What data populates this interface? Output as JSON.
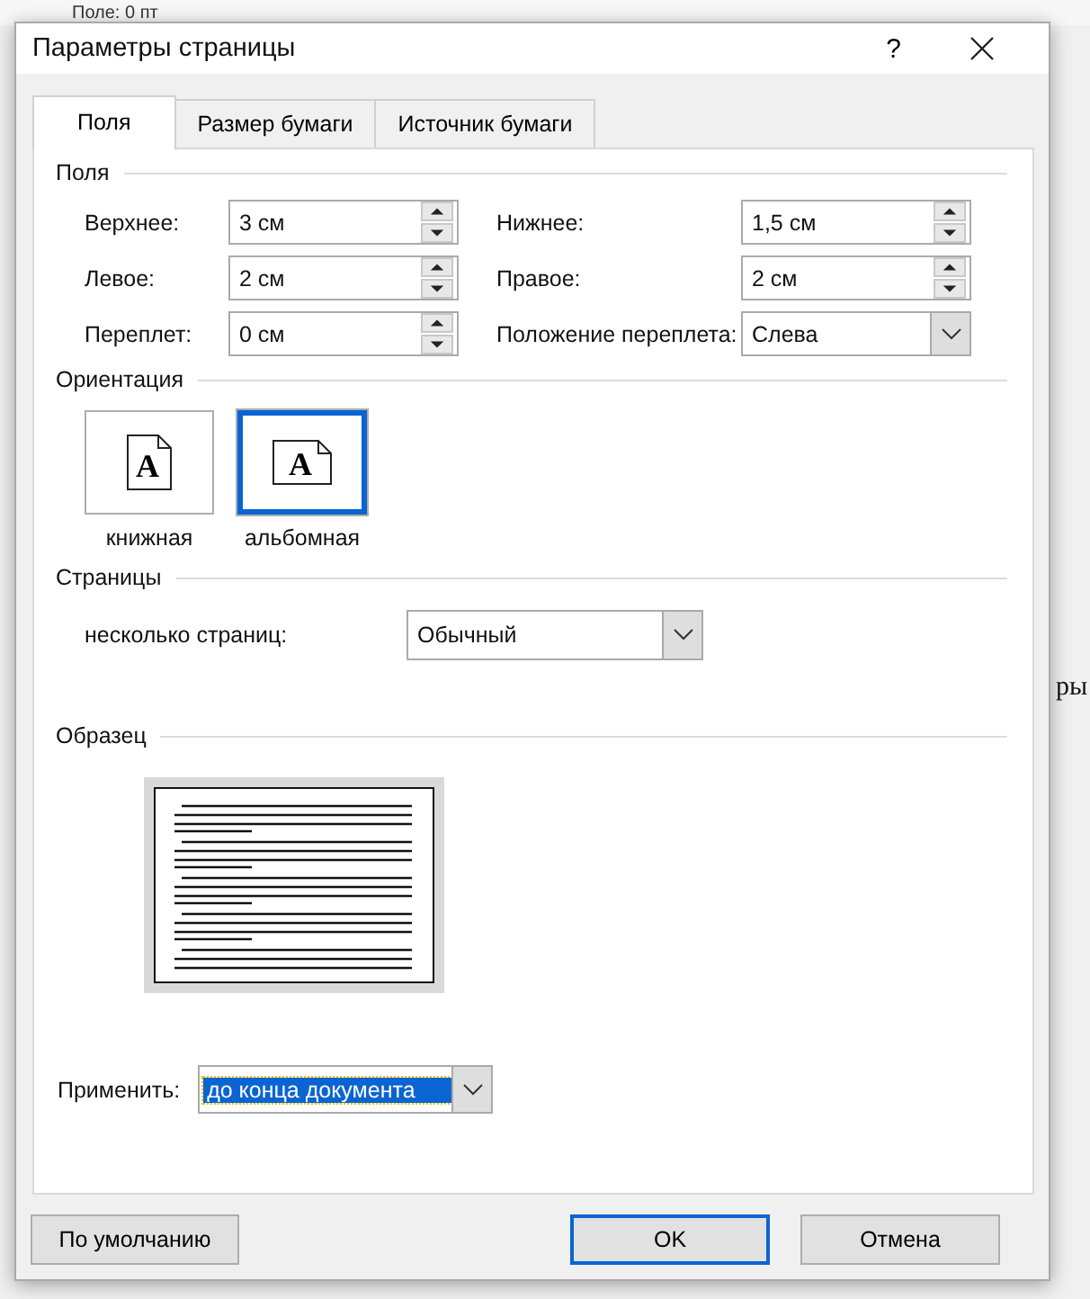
{
  "background": {
    "ruler_text": "Поле: 0 пт",
    "text_fragment": "ры"
  },
  "window": {
    "title": "Параметры страницы",
    "help": "?"
  },
  "tabs": [
    {
      "label": "Поля",
      "selected": true
    },
    {
      "label": "Размер бумаги",
      "selected": false
    },
    {
      "label": "Источник бумаги",
      "selected": false
    }
  ],
  "margins": {
    "heading": "Поля",
    "fields": [
      {
        "label": "Верхнее:",
        "value": "3 см",
        "kind": "spin"
      },
      {
        "label": "Нижнее:",
        "value": "1,5 см",
        "kind": "spin"
      },
      {
        "label": "Левое:",
        "value": "2 см",
        "kind": "spin"
      },
      {
        "label": "Правое:",
        "value": "2 см",
        "kind": "spin"
      },
      {
        "label": "Переплет:",
        "value": "0 см",
        "kind": "spin"
      },
      {
        "label": "Положение переплета:",
        "value": "Слева",
        "kind": "select"
      }
    ]
  },
  "orientation": {
    "heading": "Ориентация",
    "options": [
      {
        "label": "книжная",
        "letter": "A",
        "kind": "portrait",
        "selected": false
      },
      {
        "label": "альбомная",
        "letter": "A",
        "kind": "landscape",
        "selected": true
      }
    ]
  },
  "pages": {
    "heading": "Страницы",
    "label": "несколько страниц:",
    "value": "Обычный"
  },
  "sample": {
    "heading": "Образец"
  },
  "apply": {
    "label": "Применить:",
    "value": "до конца документа",
    "highlighted": true
  },
  "buttons": [
    {
      "label": "По умолчанию",
      "default": false
    },
    {
      "label": "OK",
      "default": true
    },
    {
      "label": "Отмена",
      "default": false
    }
  ]
}
